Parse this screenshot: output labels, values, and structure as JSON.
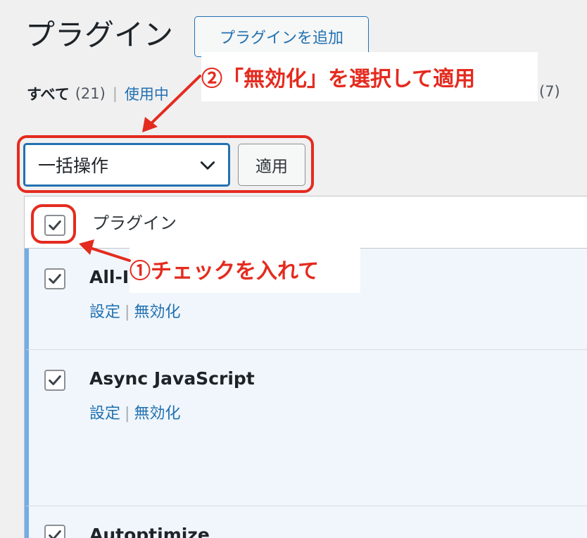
{
  "header": {
    "title": "プラグイン",
    "add_new_label": "プラグインを追加"
  },
  "filters": {
    "all_label": "すべて",
    "all_count": "(21)",
    "separator": "|",
    "active_label": "使用中",
    "tail_count": "(7)"
  },
  "bulk_actions": {
    "selected": "一括操作",
    "apply_label": "適用"
  },
  "table": {
    "column_plugin": "プラグイン",
    "rows": [
      {
        "name": "All-I",
        "settings": "設定",
        "deactivate": "無効化",
        "checked": true
      },
      {
        "name": "Async JavaScript",
        "settings": "設定",
        "deactivate": "無効化",
        "checked": true
      },
      {
        "name": "Autoptimize",
        "checked": true
      }
    ],
    "action_separator": "|"
  },
  "annotations": {
    "step1": "①チェックを入れて",
    "step2": "②「無効化」を選択して適用",
    "color": "#e42b1f"
  },
  "colors": {
    "accent": "#2271b1",
    "active_row_bg": "#f0f6fc",
    "active_row_border": "#72aee6",
    "background": "#f0f0f1"
  }
}
